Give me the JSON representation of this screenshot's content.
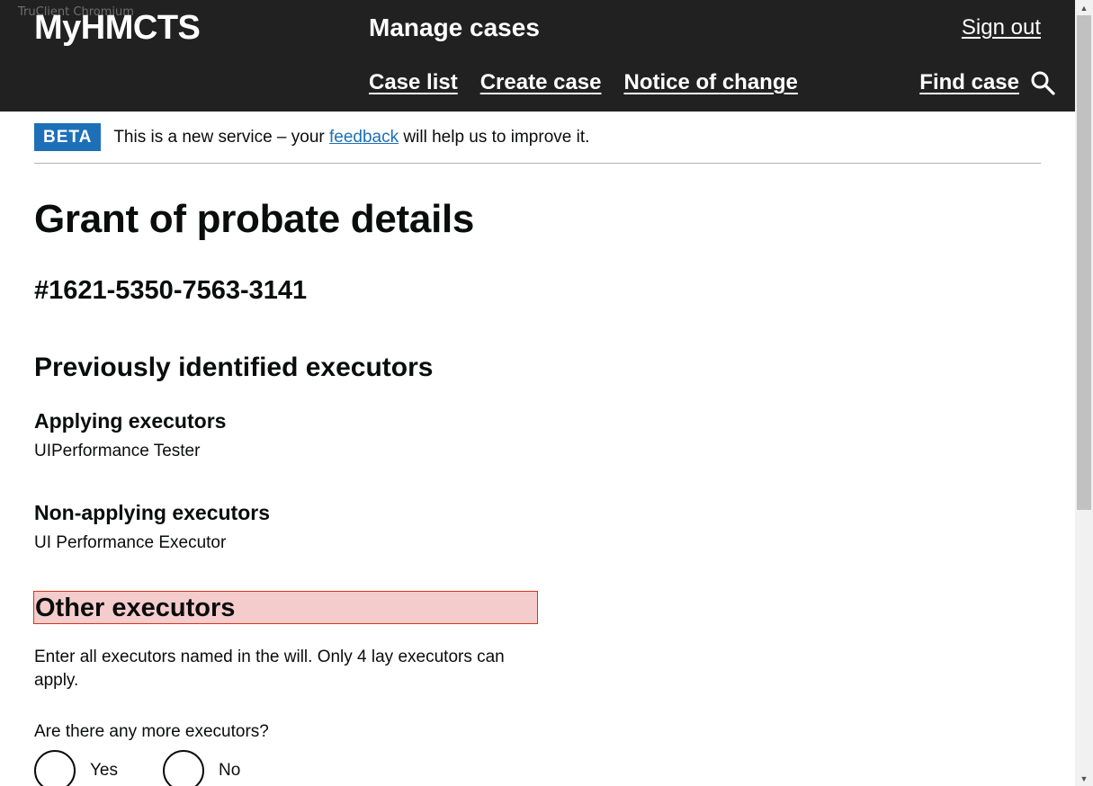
{
  "header": {
    "overlay_label": "TruClient Chromium",
    "brand": "MyHMCTS",
    "service_name": "Manage cases",
    "sign_out": "Sign out",
    "nav": [
      {
        "label": "Case list"
      },
      {
        "label": "Create case"
      },
      {
        "label": "Notice of change"
      }
    ],
    "find_case": "Find case"
  },
  "phase_banner": {
    "tag": "BETA",
    "text_before": "This is a new service – your ",
    "link": "feedback",
    "text_after": " will help us to improve it."
  },
  "main": {
    "title": "Grant of probate details",
    "case_reference": "#1621-5350-7563-3141",
    "section_heading": "Previously identified executors",
    "applying": {
      "heading": "Applying executors",
      "value": "UIPerformance Tester"
    },
    "non_applying": {
      "heading": "Non-applying executors",
      "value": "UI Performance Executor"
    },
    "other": {
      "heading": "Other executors",
      "hint": "Enter all executors named in the will. Only 4 lay executors can apply.",
      "question": "Are there any more executors?",
      "options": [
        {
          "label": "Yes"
        },
        {
          "label": "No"
        }
      ]
    }
  },
  "colors": {
    "header_bg": "#212121",
    "beta_tag": "#1d70b8",
    "highlight_bg": "#f4cccc",
    "highlight_border": "#d4351c"
  },
  "icons": {
    "find_case": "search-icon"
  }
}
